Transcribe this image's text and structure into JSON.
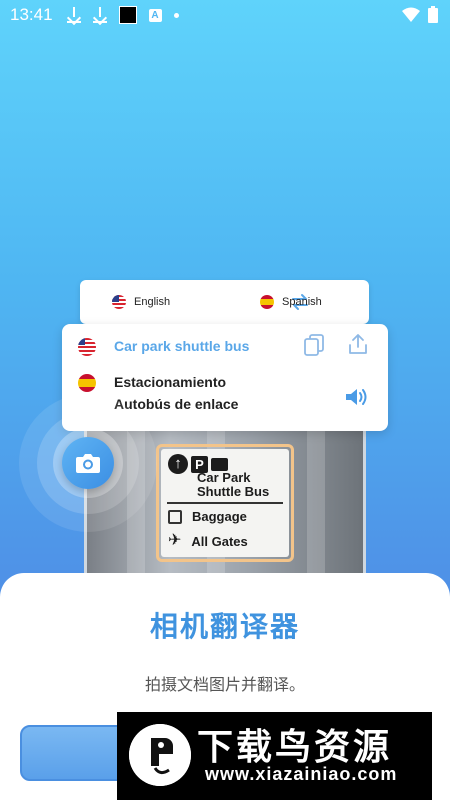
{
  "status_bar": {
    "time": "13:41",
    "icons": [
      "download-icon",
      "download-icon",
      "black-square-icon",
      "a-icon",
      "dot-icon",
      "wifi-icon",
      "battery-icon"
    ]
  },
  "language_bar": {
    "source_language": "English",
    "target_language": "Spanish",
    "swap_icon": "swap-arrows-icon"
  },
  "translation": {
    "source_text": "Car park shuttle bus",
    "target_line1": "Estacionamiento",
    "target_line2": "Autobús de enlace"
  },
  "sign": {
    "line1": "Car Park",
    "line2": "Shuttle Bus",
    "row1": "Baggage",
    "row2": "All Gates"
  },
  "sheet": {
    "title": "相机翻译器",
    "subtitle": "拍摄文档图片并翻译。"
  },
  "watermark": {
    "title": "下载鸟资源",
    "url": "www.xiazainiao.com"
  },
  "colors": {
    "accent": "#3f93df",
    "source_text": "#5aa7e8",
    "background_top": "#5fd3fb",
    "background_bottom": "#3f7fde"
  }
}
